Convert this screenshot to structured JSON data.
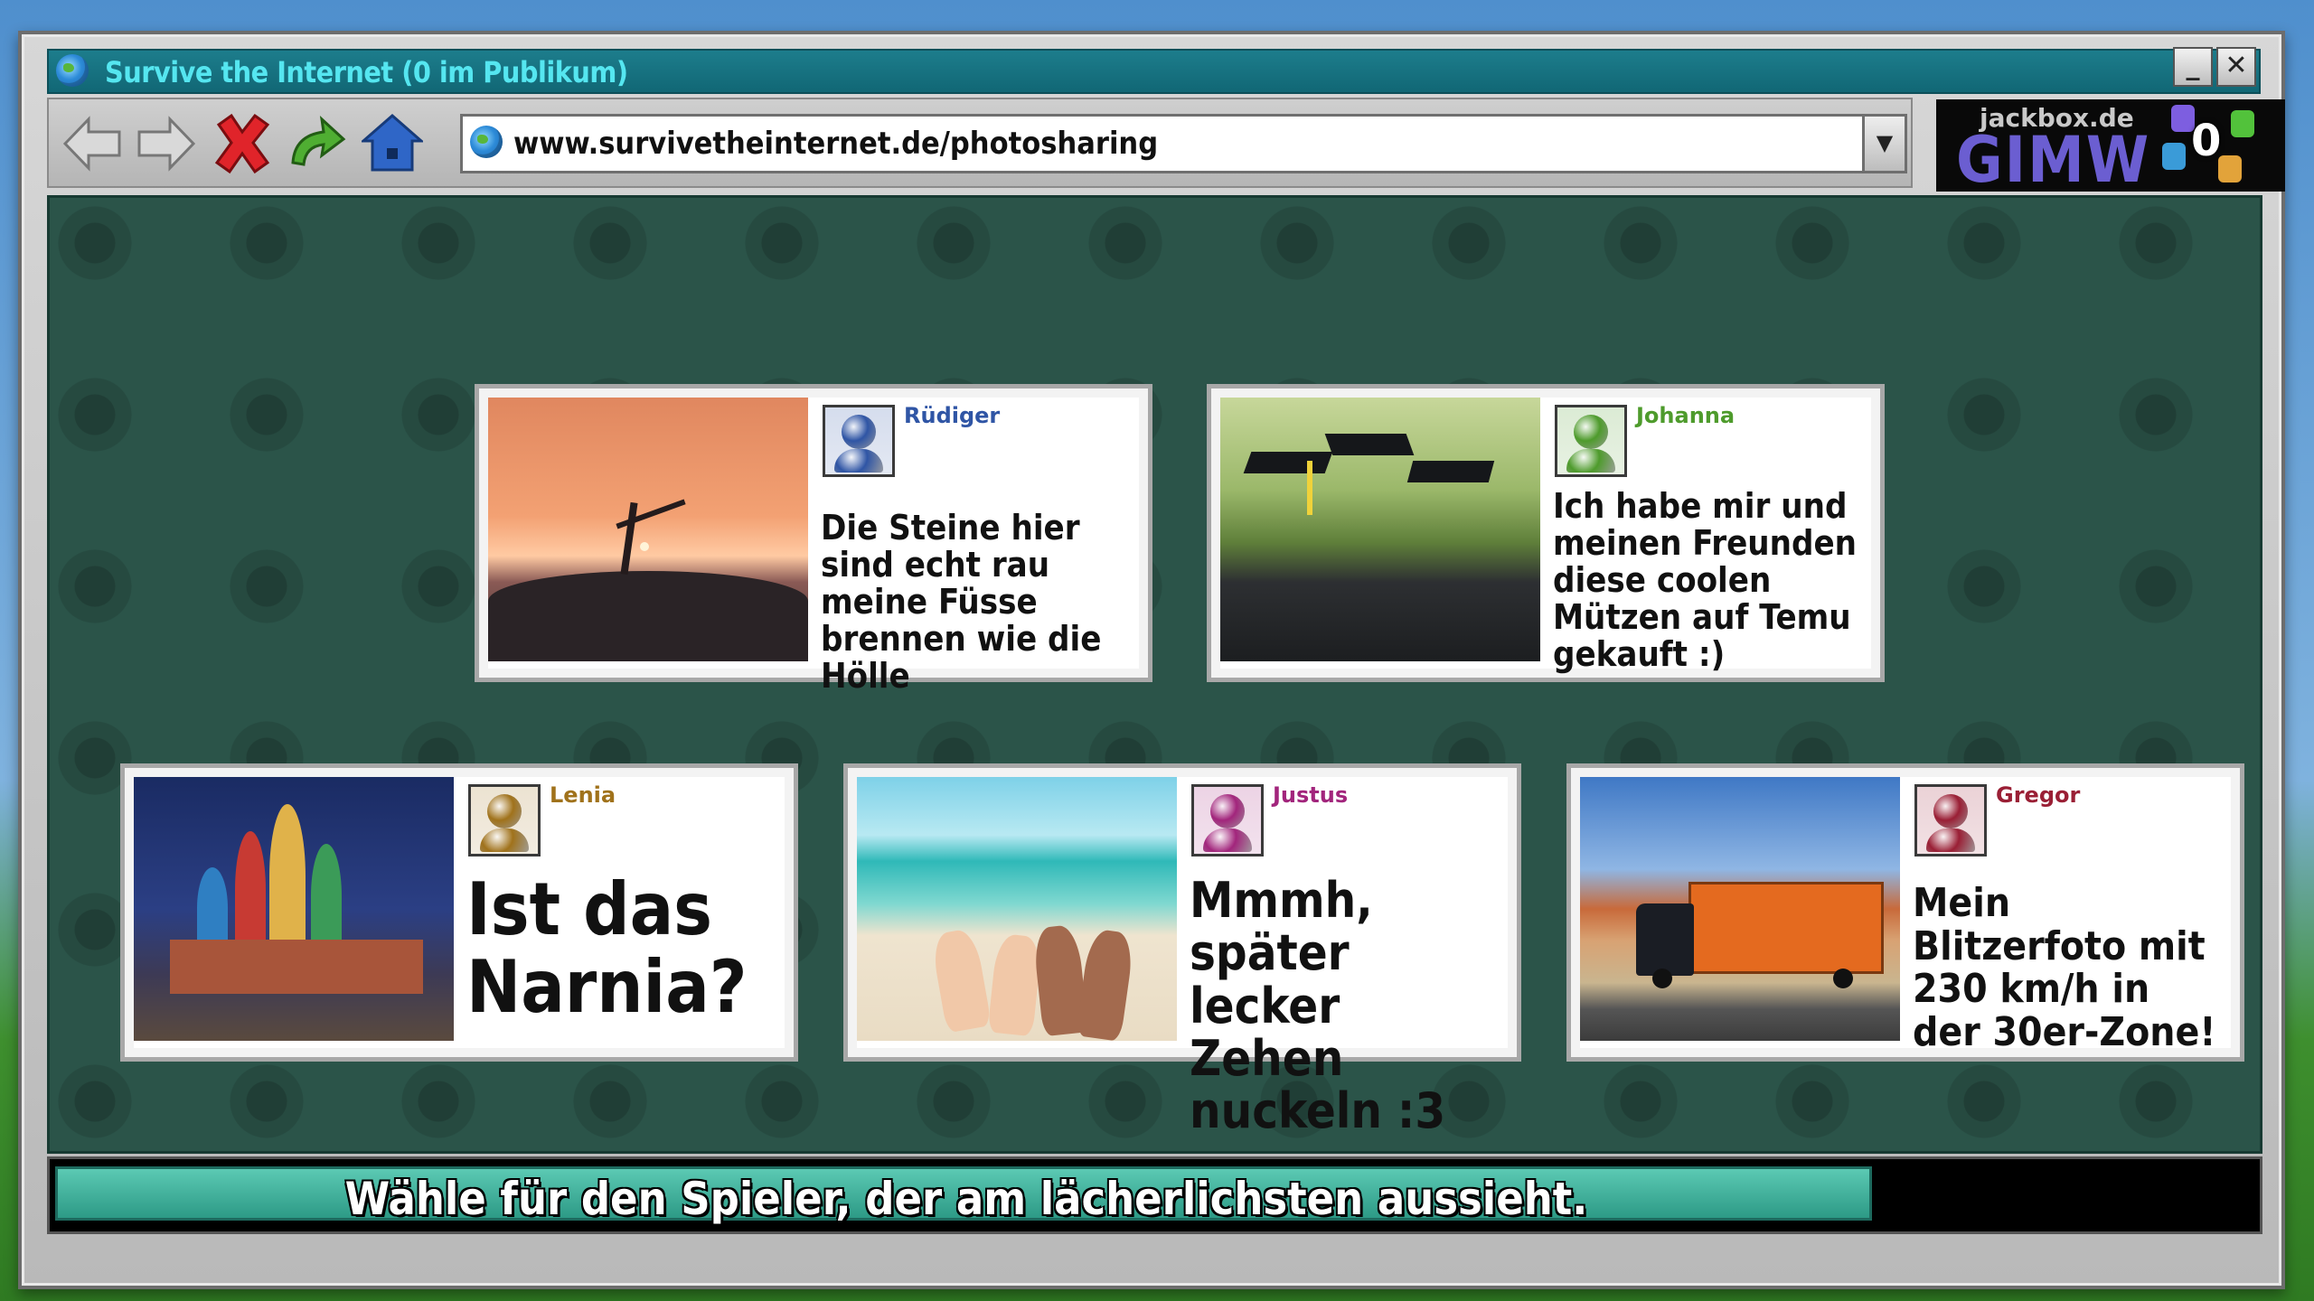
{
  "window": {
    "title": "Survive the Internet (0 im Publikum)",
    "minimize": "_",
    "close": "✕"
  },
  "toolbar": {
    "url": "www.survivetheinternet.de/photosharing",
    "icons": [
      "back-arrow-icon",
      "forward-arrow-icon",
      "stop-x-icon",
      "refresh-arrow-icon",
      "home-icon"
    ]
  },
  "logo": {
    "site": "jackbox.de",
    "room": "GIMW",
    "score": "0"
  },
  "cards": [
    {
      "name": "Rüdiger",
      "caption": "Die Steine hier sind echt rau meine Füsse brennen wie die Hölle",
      "color": "#2f55a5",
      "photo": "yoga-silhouette-sunset"
    },
    {
      "name": "Johanna",
      "caption": "Ich habe mir und meinen Freunden diese coolen Mützen auf Temu gekauft :)",
      "color": "#4e9b2c",
      "photo": "graduation-caps"
    },
    {
      "name": "Lenia",
      "caption": "Ist das Narnia?",
      "color": "#a0721b",
      "photo": "saint-basils-cathedral"
    },
    {
      "name": "Justus",
      "caption": "Mmmh, später lecker Zehen nuckeln :3",
      "color": "#a2257c",
      "photo": "beach-feet"
    },
    {
      "name": "Gregor",
      "caption": "Mein Blitzerfoto mit 230 km/h in der 30er-Zone!",
      "color": "#9a1f35",
      "photo": "orange-truck-desert"
    }
  ],
  "instruction": "Wähle für den Spieler, der am lächerlichsten aussieht."
}
